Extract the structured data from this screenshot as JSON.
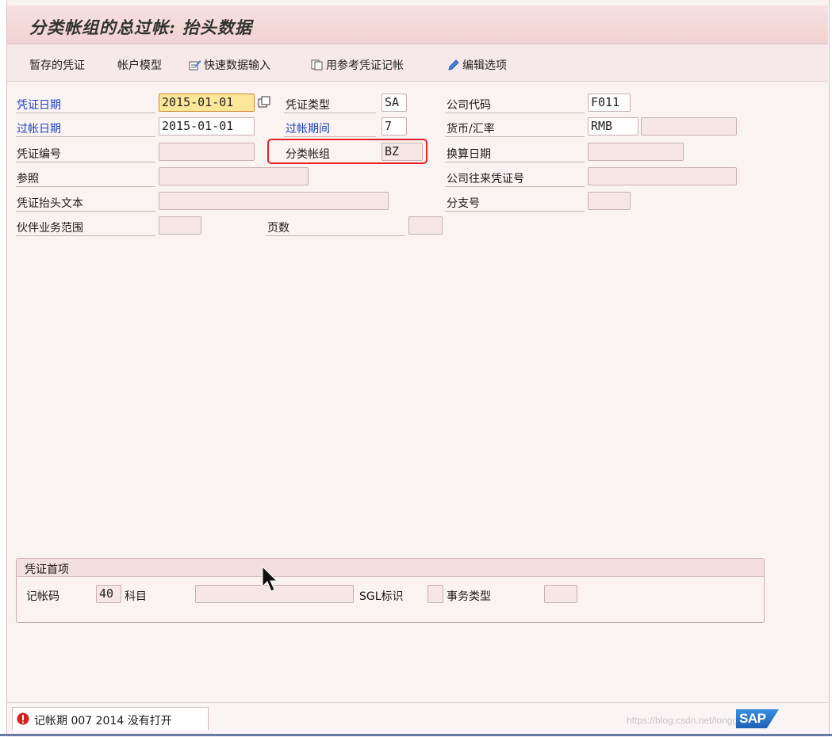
{
  "window": {
    "title": "分类帐组的总过帐: 抬头数据"
  },
  "toolbar": {
    "items": [
      "暂存的凭证",
      "帐户模型",
      "快速数据输入",
      "用参考凭证记帐",
      "编辑选项"
    ]
  },
  "header": {
    "doc_date_label": "凭证日期",
    "doc_date_value": "2015-01-01",
    "posting_date_label": "过帐日期",
    "posting_date_value": "2015-01-01",
    "doc_number_label": "凭证编号",
    "reference_label": "参照",
    "header_text_label": "凭证抬头文本",
    "partner_ba_label": "伙伴业务范围",
    "doc_type_label": "凭证类型",
    "doc_type_value": "SA",
    "period_label": "过帐期间",
    "period_value": "7",
    "ledger_group_label": "分类帐组",
    "ledger_group_value": "BZ",
    "page_label": "页数",
    "company_code_label": "公司代码",
    "company_code_value": "F011",
    "currency_label": "货币/汇率",
    "currency_value": "RMB",
    "translation_date_label": "换算日期",
    "cross_cc_label": "公司往来凭证号",
    "branch_label": "分支号"
  },
  "first_item": {
    "title": "凭证首项",
    "posting_key_label": "记帐码",
    "posting_key_value": "40",
    "account_label": "科目",
    "sgl_label": "SGL标识",
    "trans_type_label": "事务类型"
  },
  "status": {
    "message": "记帐期 007 2014 没有打开",
    "watermark": "https://blog.csdn.net/longguomao",
    "logo": "SAP"
  },
  "colors": {
    "field_label_link": "#1b43c9",
    "highlight_border": "#e52222",
    "focus_field": "#fbe69a"
  }
}
